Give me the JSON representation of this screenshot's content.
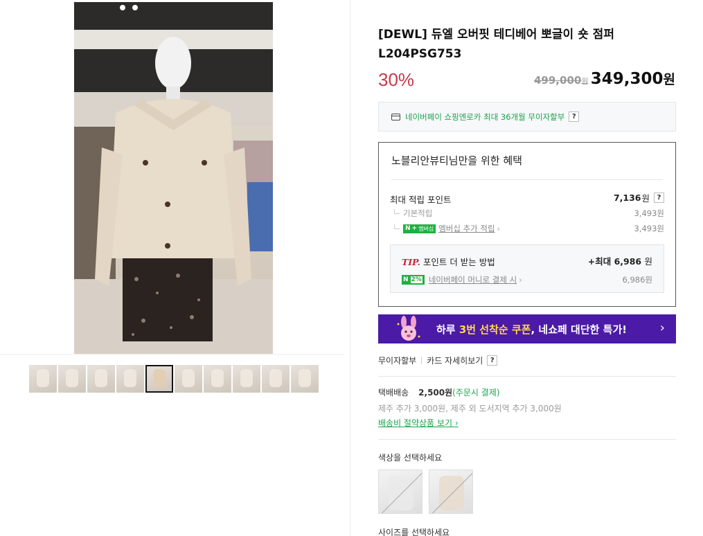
{
  "product": {
    "title": "[DEWL] 듀엘 오버핏 테디베어 뽀글이 숏 점퍼 L204PSG753",
    "discount": "30%",
    "original_price": "499,000",
    "original_unit": "원",
    "price": "349,300",
    "price_unit": "원"
  },
  "npay": {
    "text": "네이버페이 쇼핑엔로카 최대 36개월 무이자할부",
    "help": "?"
  },
  "benefit": {
    "title": "노블리안뷰티님만을 위한 혜택",
    "max_points_label": "최대 적립 포인트",
    "max_points_value": "7,136",
    "unit": "원",
    "help": "?",
    "basic_label": "기본적립",
    "basic_value": "3,493원",
    "membership_badge": "N",
    "membership_badge_plus": "+",
    "membership_badge_text": "멤버십",
    "membership_label": "멤버십 추가 적립",
    "membership_value": "3,493원",
    "tip_word": "TIP.",
    "tip_label": "포인트 더 받는 방법",
    "tip_value": "+최대 6,986",
    "tip_unit": "원",
    "npay_money_badge": "N",
    "npay_money_pct": "2%",
    "npay_money_label": "네이버페이 머니로 결제 시",
    "npay_money_value": "6,986원"
  },
  "banner": {
    "text_prefix": "하루 ",
    "text_highlight": "3번 선착순 쿠폰",
    "text_suffix": ", 네쇼페 대단한 특가!",
    "arrow": "›"
  },
  "installment": {
    "label": "무이자할부",
    "card_link": "카드 자세히보기",
    "help": "?"
  },
  "shipping": {
    "label": "택배배송",
    "fee": "2,500원",
    "pay_note": "(주문시 결제)",
    "extra": "제주 추가 3,000원, 제주 외 도서지역 추가 3,000원",
    "saving_link": "배송비 절약상품 보기",
    "chevron": "›"
  },
  "options": {
    "color_label": "색상을 선택하세요",
    "size_label": "사이즈를 선택하세요"
  },
  "thumbnails": [
    "thumb-1",
    "thumb-2",
    "thumb-3",
    "thumb-4",
    "thumb-5",
    "thumb-6",
    "thumb-7",
    "thumb-8",
    "thumb-9",
    "thumb-10"
  ],
  "colors": {
    "accent_red": "#c8384b",
    "naver_green": "#1aa34a",
    "banner_purple": "#4b1aa6",
    "banner_yellow": "#ffd84a"
  }
}
